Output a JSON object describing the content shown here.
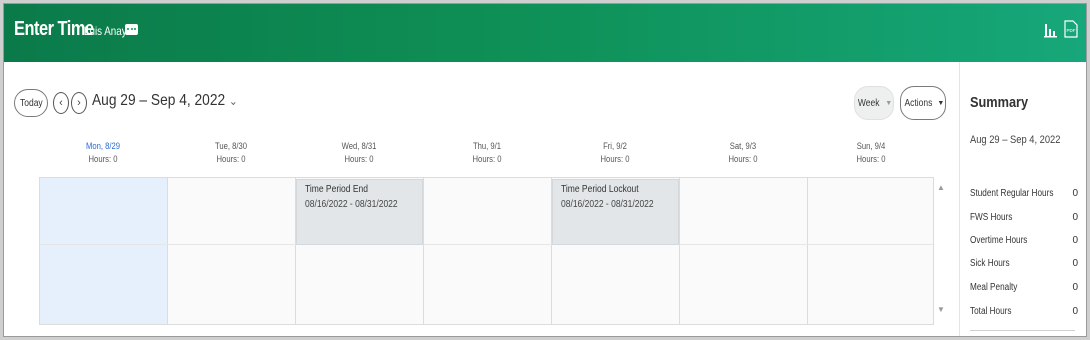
{
  "header": {
    "title": "Enter Time",
    "worker_name": "Luis Anaya",
    "icons": [
      "related-actions-icon",
      "chart-icon",
      "pdf-icon"
    ]
  },
  "toolbar": {
    "today_label": "Today",
    "prev_icon": "chevron-left-icon",
    "next_icon": "chevron-right-icon",
    "date_range": "Aug 29 – Sep 4, 2022",
    "view_label": "Week",
    "actions_label": "Actions"
  },
  "days": [
    {
      "label": "Mon, 8/29",
      "hours": "Hours: 0"
    },
    {
      "label": "Tue, 8/30",
      "hours": "Hours: 0"
    },
    {
      "label": "Wed, 8/31",
      "hours": "Hours: 0"
    },
    {
      "label": "Thu, 9/1",
      "hours": "Hours: 0"
    },
    {
      "label": "Fri, 9/2",
      "hours": "Hours: 0"
    },
    {
      "label": "Sat, 9/3",
      "hours": "Hours: 0"
    },
    {
      "label": "Sun, 9/4",
      "hours": "Hours: 0"
    }
  ],
  "events": [
    {
      "title": "Time Period End",
      "range": "08/16/2022 - 08/31/2022"
    },
    {
      "title": "Time Period Lockout",
      "range": "08/16/2022 - 08/31/2022"
    }
  ],
  "summary": {
    "title": "Summary",
    "range": "Aug 29 – Sep 4, 2022",
    "rows": [
      {
        "label": "Student Regular Hours",
        "value": "0"
      },
      {
        "label": "FWS Hours",
        "value": "0"
      },
      {
        "label": "Overtime Hours",
        "value": "0"
      },
      {
        "label": "Sick Hours",
        "value": "0"
      },
      {
        "label": "Meal Penalty",
        "value": "0"
      },
      {
        "label": "Total Hours",
        "value": "0"
      }
    ]
  },
  "colors": {
    "header_start": "#0b7a4a",
    "header_end": "#16a77a",
    "today_column": "#e6f0fc",
    "today_text": "#2a6bd6",
    "event_bg": "#e2e6e8"
  }
}
